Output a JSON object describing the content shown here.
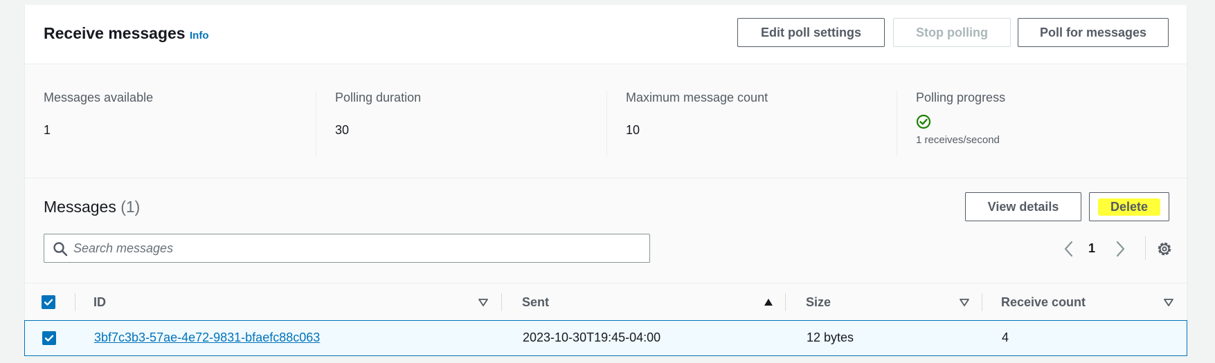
{
  "header": {
    "title": "Receive messages",
    "info_label": "Info",
    "buttons": {
      "edit_poll_settings": "Edit poll settings",
      "stop_polling": "Stop polling",
      "poll_for_messages": "Poll for messages"
    }
  },
  "stats": {
    "messages_available": {
      "label": "Messages available",
      "value": "1"
    },
    "polling_duration": {
      "label": "Polling duration",
      "value": "30"
    },
    "max_message_count": {
      "label": "Maximum message count",
      "value": "10"
    },
    "polling_progress": {
      "label": "Polling progress",
      "rate": "1 receives/second"
    }
  },
  "messages": {
    "title": "Messages",
    "count": "(1)",
    "view_details_label": "View details",
    "delete_label": "Delete",
    "search_placeholder": "Search messages",
    "current_page": "1",
    "columns": [
      "ID",
      "Sent",
      "Size",
      "Receive count"
    ],
    "rows": [
      {
        "id": "3bf7c3b3-57ae-4e72-9831-bfaefc88c063",
        "sent": "2023-10-30T19:45-04:00",
        "size": "12 bytes",
        "receive_count": "4"
      }
    ]
  },
  "colors": {
    "accent_blue": "#0073bb",
    "success_green": "#1d8102",
    "highlight_yellow": "#ffff3a"
  }
}
